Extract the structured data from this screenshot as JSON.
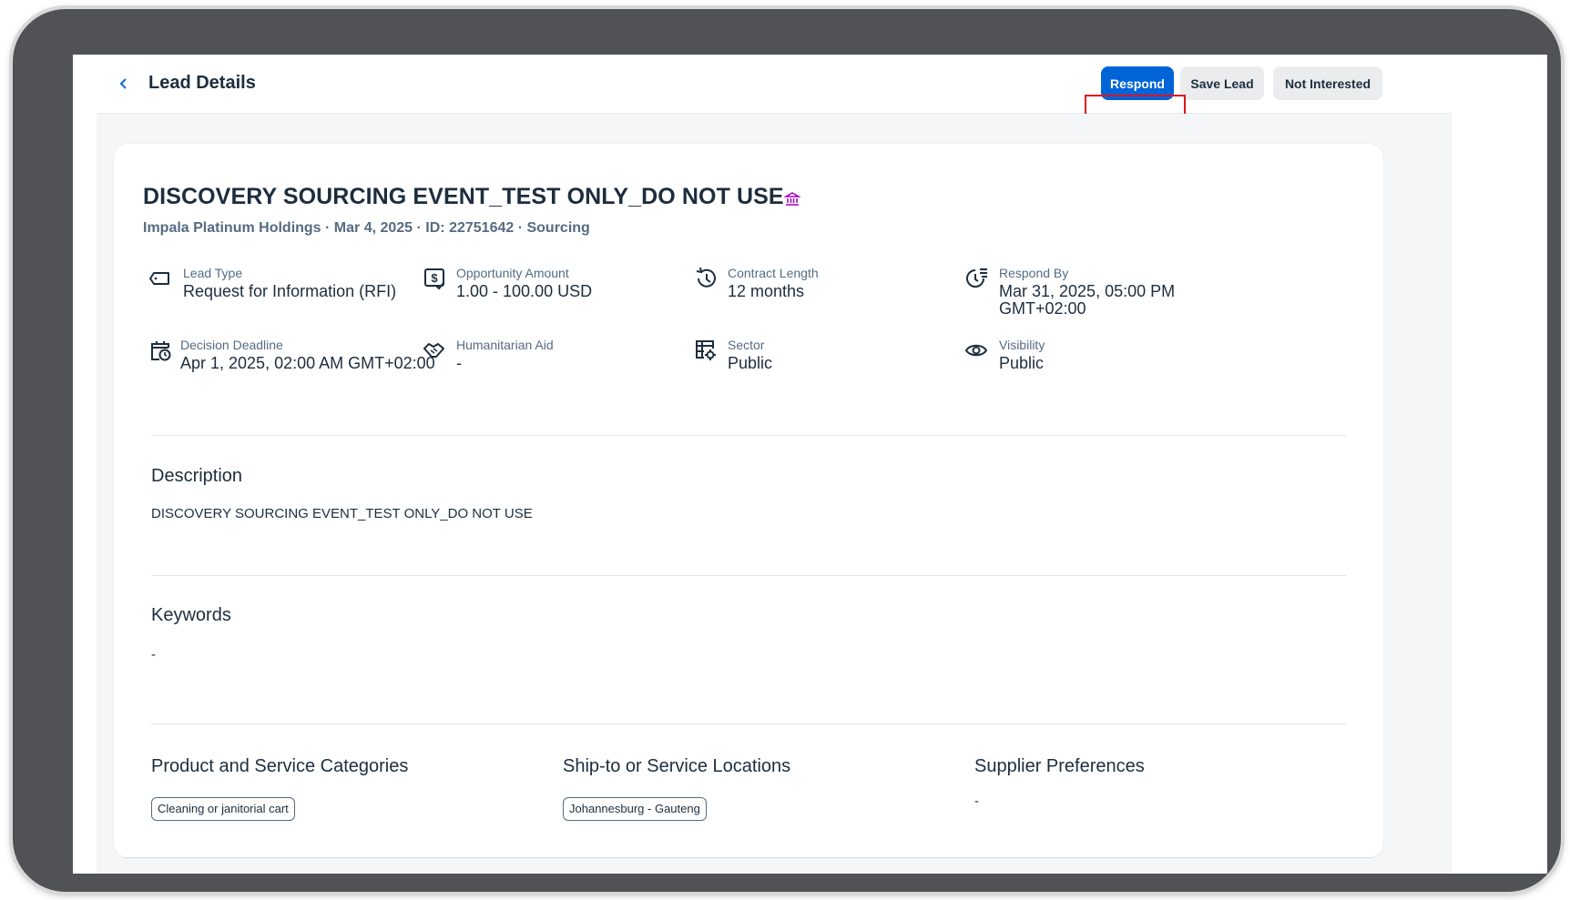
{
  "header": {
    "back_icon": "chevron-left-icon",
    "title": "Lead Details",
    "buttons": {
      "respond": "Respond",
      "save": "Save Lead",
      "not_interested": "Not Interested"
    }
  },
  "lead": {
    "title": "DISCOVERY SOURCING EVENT_TEST ONLY_DO NOT USE",
    "title_icon": "bank-icon",
    "subline": "Impala Platinum Holdings · Mar 4, 2025 · ID: 22751642 · Sourcing"
  },
  "facts": [
    {
      "icon": "tag-icon",
      "label": "Lead Type",
      "value": "Request for Information (RFI)"
    },
    {
      "icon": "dollar-document-icon",
      "label": "Opportunity Amount",
      "value": "1.00 - 100.00 USD"
    },
    {
      "icon": "history-icon",
      "label": "Contract Length",
      "value": "12 months"
    },
    {
      "icon": "clock-list-icon",
      "label": "Respond By",
      "value": "Mar 31, 2025, 05:00 PM",
      "value2": "GMT+02:00"
    },
    {
      "icon": "calendar-clock-icon",
      "label": "Decision Deadline",
      "value": "Apr 1, 2025, 02:00 AM GMT+02:00"
    },
    {
      "icon": "handshake-icon",
      "label": "Humanitarian Aid",
      "value": "-"
    },
    {
      "icon": "table-gear-icon",
      "label": "Sector",
      "value": "Public"
    },
    {
      "icon": "eye-icon",
      "label": "Visibility",
      "value": "Public"
    }
  ],
  "description": {
    "heading": "Description",
    "text": "DISCOVERY SOURCING EVENT_TEST ONLY_DO NOT USE"
  },
  "keywords": {
    "heading": "Keywords",
    "text": "-"
  },
  "categories": {
    "heading": "Product and Service Categories",
    "tag": "Cleaning or janitorial cart"
  },
  "locations": {
    "heading": "Ship-to or Service Locations",
    "tag": "Johannesburg - Gauteng"
  },
  "supplier_prefs": {
    "heading": "Supplier Preferences",
    "text": "-"
  },
  "colors": {
    "accent": "#0064d9",
    "highlight": "#e0141e",
    "title": "#1d2d3e",
    "muted": "#556b82",
    "bank_icon": "#a100c2"
  }
}
